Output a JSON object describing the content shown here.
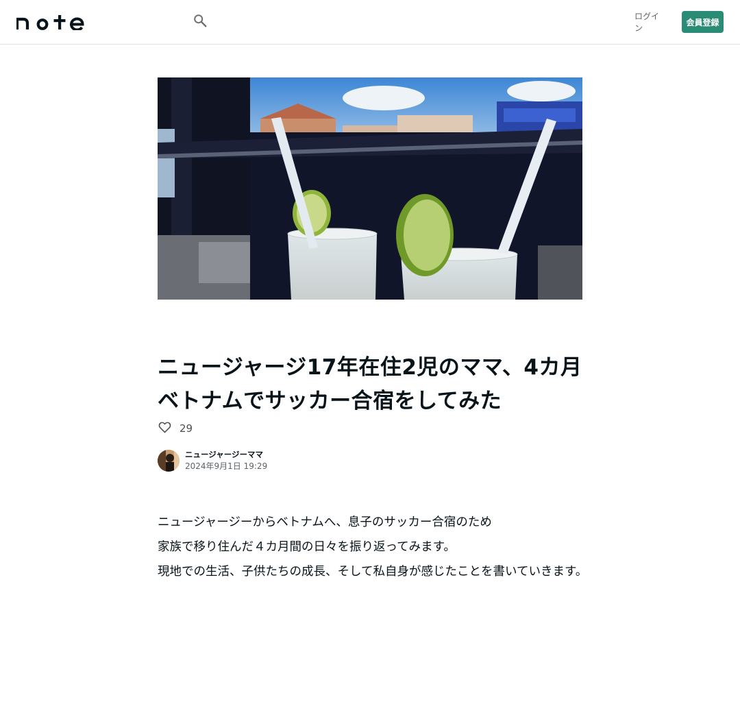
{
  "header": {
    "logo_text": "note",
    "search_icon": "search-icon",
    "login_label": "ログイン",
    "signup_label": "会員登録",
    "accent_color": "#2b8c75"
  },
  "article": {
    "hero_image_alt": "Two lime cocktails with straws by a window",
    "title": "ニュージャージ17年在住2児のママ、4カ月ベトナムでサッカー合宿をしてみた",
    "like_icon": "heart-outline-icon",
    "like_count": "29",
    "author_name": "ニュージャージーママ",
    "published_at": "2024年9月1日 19:29",
    "paragraphs": [
      "ニュージャージーからベトナムへ、息子のサッカー合宿のため",
      "家族で移り住んだ４カ月間の日々を振り返ってみます。",
      "現地での生活、子供たちの成長、そして私自身が感じたことを書いていきます。"
    ]
  }
}
